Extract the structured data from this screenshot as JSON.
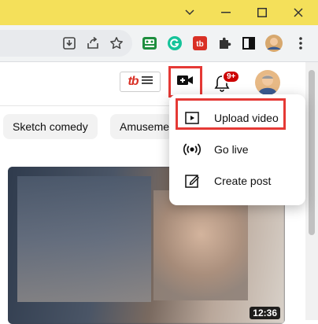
{
  "browser": {
    "title_bar_color": "#f4e05a",
    "window_controls": [
      "minimize-icon",
      "maximize-icon",
      "close-icon"
    ],
    "toolbar_icons": [
      "download-icon",
      "share-icon",
      "bookmark-star-icon",
      "extension-green-icon",
      "grammarly-icon",
      "extension-red-icon",
      "puzzle-icon",
      "sidebar-icon",
      "profile-avatar",
      "kebab-menu-icon"
    ]
  },
  "youtube": {
    "tubebuddy_label": "tb",
    "notification_badge": "9+",
    "chips": [
      "Sketch comedy",
      "Amuseme"
    ],
    "video_duration": "12:36",
    "create_menu": {
      "items": [
        {
          "label": "Upload video",
          "icon": "upload-video-icon"
        },
        {
          "label": "Go live",
          "icon": "go-live-icon"
        },
        {
          "label": "Create post",
          "icon": "create-post-icon"
        }
      ]
    },
    "highlight_color": "#e53935"
  }
}
